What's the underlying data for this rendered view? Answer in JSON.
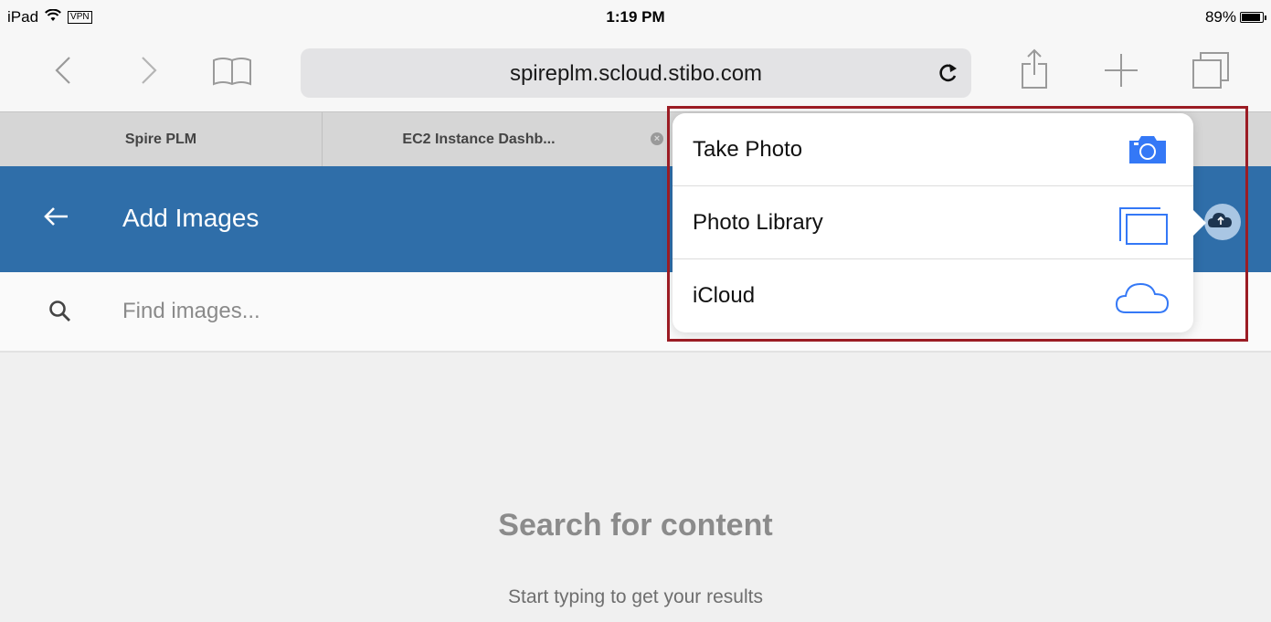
{
  "status_bar": {
    "device": "iPad",
    "vpn_label": "VPN",
    "time": "1:19 PM",
    "battery": "89%",
    "battery_level": 0.89
  },
  "toolbar": {
    "url": "spireplm.scloud.stibo.com",
    "icons": [
      "back-arrow-icon",
      "forward-arrow-icon",
      "bookmarks-icon",
      "reload-icon",
      "share-icon",
      "new-tab-icon",
      "tabs-icon"
    ]
  },
  "tabs": [
    {
      "label": "Spire PLM"
    },
    {
      "label": "EC2 Instance Dashb..."
    }
  ],
  "app_header": {
    "title": "Add Images"
  },
  "search": {
    "placeholder": "Find images..."
  },
  "empty_state": {
    "title": "Search for content",
    "subtitle": "Start typing to get your results"
  },
  "popover": {
    "items": [
      {
        "label": "Take Photo",
        "icon": "camera-icon"
      },
      {
        "label": "Photo Library",
        "icon": "photo-library-icon"
      },
      {
        "label": "iCloud",
        "icon": "icloud-icon"
      }
    ]
  },
  "colors": {
    "header_blue": "#2f6ea9",
    "ios_blue": "#3478f6",
    "highlight_red": "#9b1c24"
  }
}
